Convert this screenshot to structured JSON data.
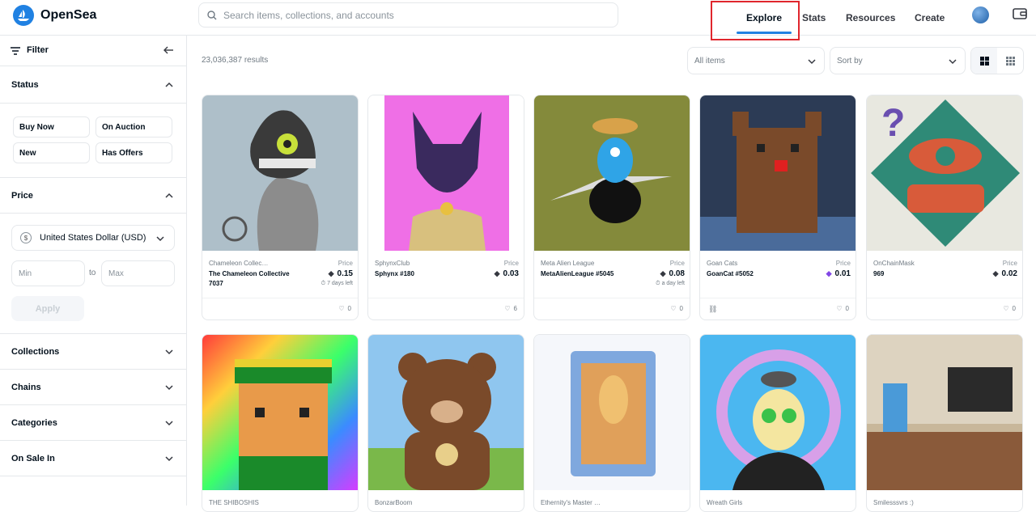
{
  "brand": {
    "name": "OpenSea"
  },
  "search": {
    "placeholder": "Search items, collections, and accounts"
  },
  "nav": {
    "explore": "Explore",
    "stats": "Stats",
    "resources": "Resources",
    "create": "Create"
  },
  "sidebar": {
    "filter_label": "Filter",
    "status": {
      "title": "Status",
      "buttons": [
        "Buy Now",
        "On Auction",
        "New",
        "Has Offers"
      ]
    },
    "price": {
      "title": "Price",
      "currency_symbol": "$",
      "currency": "United States Dollar (USD)",
      "min_placeholder": "Min",
      "to": "to",
      "max_placeholder": "Max",
      "apply": "Apply"
    },
    "sections": [
      "Collections",
      "Chains",
      "Categories",
      "On Sale In"
    ]
  },
  "main": {
    "results": "23,036,387 results",
    "filter_select": "All items",
    "sort_select": "Sort by"
  },
  "cards": [
    {
      "collection": "Chameleon Collec…",
      "name": "The Chameleon Collective 7037",
      "price_label": "Price",
      "price": "0.15",
      "time_left": "7 days left",
      "likes": "0",
      "bg": "#aebfc9"
    },
    {
      "collection": "SphynxClub",
      "name": "Sphynx #180",
      "price_label": "Price",
      "price": "0.03",
      "time_left": "",
      "likes": "6",
      "bg": "#ef6fe6"
    },
    {
      "collection": "Meta Alien League",
      "name": "MetaAlienLeague #5045",
      "price_label": "Price",
      "price": "0.08",
      "time_left": "a day left",
      "likes": "0",
      "bg": "#848a3b"
    },
    {
      "collection": "Goan Cats",
      "name": "GoanCat #5052",
      "price_label": "Price",
      "price": "0.01",
      "time_left": "",
      "likes": "0",
      "bg": "#2c3b55"
    },
    {
      "collection": "OnChainMask",
      "name": "969",
      "price_label": "Price",
      "price": "0.02",
      "time_left": "",
      "likes": "0",
      "bg": "#e8e8e0"
    },
    {
      "collection": "THE SHIBOSHIS",
      "bg": "#ff5b9a"
    },
    {
      "collection": "BonzarBoom",
      "bg": "#8fc6ef"
    },
    {
      "collection": "Ethernity's Master …",
      "bg": "#f5f7fb"
    },
    {
      "collection": "Wreath Girls",
      "bg": "#4bb7f0"
    },
    {
      "collection": "Smilesssvrs :)",
      "bg": "#c8b79a"
    }
  ],
  "colors": {
    "accent": "#2081e2",
    "highlight": "#e0262d"
  }
}
